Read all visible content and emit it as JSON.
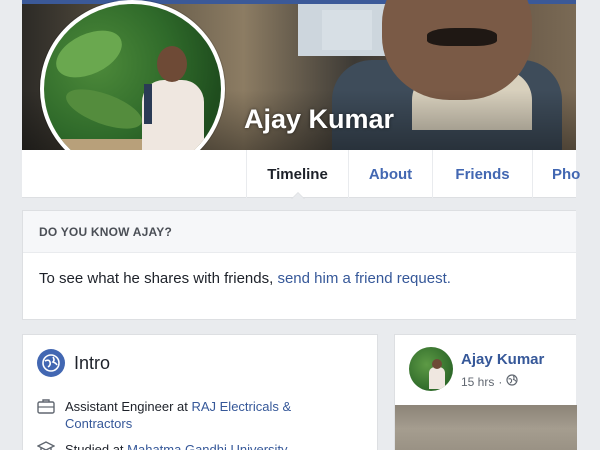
{
  "profile": {
    "name": "Ajay Kumar"
  },
  "tabs": [
    {
      "label": "Timeline"
    },
    {
      "label": "About"
    },
    {
      "label": "Friends"
    },
    {
      "label": "Pho"
    }
  ],
  "know_box": {
    "heading": "DO YOU KNOW AJAY?",
    "text": "To see what he shares with friends, ",
    "link": "send him a friend request."
  },
  "intro": {
    "title": "Intro",
    "work_prefix": "Assistant Engineer at ",
    "work_link_line1": "RAJ Electricals &",
    "work_link_line2": "Contractors",
    "study_prefix": "Studied at ",
    "study_link": "Mahatma Gandhi University"
  },
  "post": {
    "author": "Ajay Kumar",
    "time": "15 hrs",
    "separator": "·",
    "audience_icon": "globe-icon"
  },
  "icons": {
    "intro_icon": "globe-icon",
    "work_icon": "briefcase-icon",
    "study_icon": "graduation-cap-icon"
  },
  "colors": {
    "brand": "#4267b2",
    "link": "#365899",
    "background": "#e9ebee"
  }
}
